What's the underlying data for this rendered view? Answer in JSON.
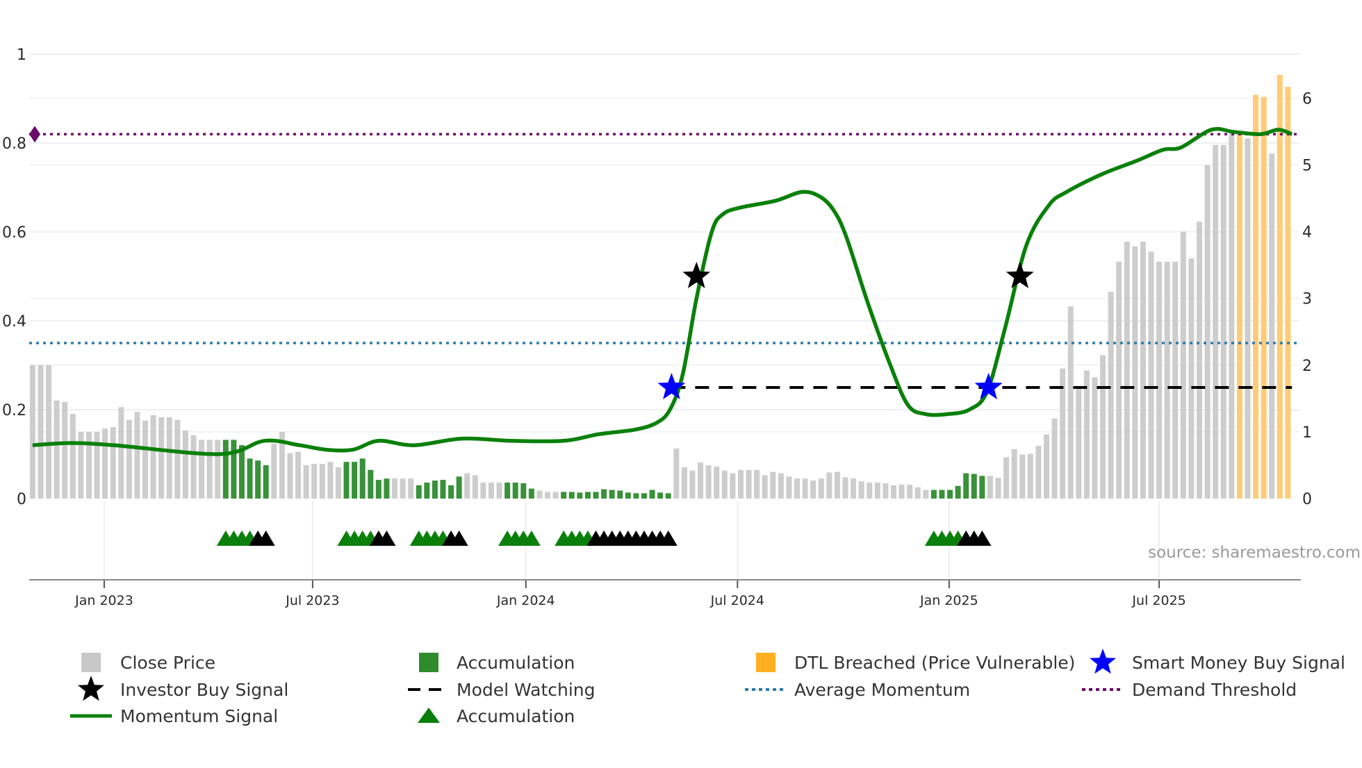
{
  "chart_data": {
    "type": "bar+line",
    "title": "",
    "left_axis": {
      "ylim": [
        0,
        1
      ],
      "ticks": [
        0,
        0.2,
        0.4,
        0.6,
        0.8,
        1
      ],
      "tick_labels": [
        "0",
        "0.2",
        "0.4",
        "0.6",
        "0.8",
        "1"
      ]
    },
    "right_axis": {
      "ylim": [
        0,
        6.35
      ],
      "ticks": [
        0,
        1,
        2,
        3,
        4,
        5,
        6
      ],
      "tick_labels": [
        "0",
        "1",
        "2",
        "3",
        "4",
        "5",
        "6"
      ]
    },
    "x_ticks": [
      {
        "week": 8.9,
        "label": "Jan 2023"
      },
      {
        "week": 34.8,
        "label": "Jul 2023"
      },
      {
        "week": 61.3,
        "label": "Jan 2024"
      },
      {
        "week": 87.6,
        "label": "Jul 2024"
      },
      {
        "week": 113.9,
        "label": "Jan 2025"
      },
      {
        "week": 140.0,
        "label": "Jul 2025"
      }
    ],
    "bars": {
      "axis": "right",
      "segments": [
        {
          "type": "close",
          "values": [
            2.0,
            2.0,
            2.0,
            1.47,
            1.45,
            1.27,
            1.0,
            1.0,
            1.0,
            1.05,
            1.07,
            1.37,
            1.18,
            1.3,
            1.17,
            1.25,
            1.22,
            1.22,
            1.18,
            1.02,
            0.95,
            0.88,
            0.88,
            0.88
          ]
        },
        {
          "type": "accum",
          "values": [
            0.88,
            0.88,
            0.8,
            0.6,
            0.57,
            0.5
          ]
        },
        {
          "type": "close",
          "values": [
            0.82,
            1.0,
            0.68,
            0.7,
            0.5,
            0.52,
            0.52,
            0.55,
            0.47
          ]
        },
        {
          "type": "accum",
          "values": [
            0.55,
            0.55,
            0.6,
            0.43,
            0.28,
            0.3
          ]
        },
        {
          "type": "close",
          "values": [
            0.3,
            0.3,
            0.3
          ]
        },
        {
          "type": "accum",
          "values": [
            0.2,
            0.24,
            0.27,
            0.28,
            0.2,
            0.33
          ]
        },
        {
          "type": "close",
          "values": [
            0.38,
            0.35,
            0.24,
            0.24,
            0.24
          ]
        },
        {
          "type": "accum",
          "values": [
            0.24,
            0.24,
            0.23,
            0.15
          ]
        },
        {
          "type": "close",
          "values": [
            0.12,
            0.1,
            0.1
          ]
        },
        {
          "type": "accum",
          "values": [
            0.1,
            0.1,
            0.09,
            0.1,
            0.1,
            0.14,
            0.13,
            0.12,
            0.09,
            0.08,
            0.08,
            0.13,
            0.09,
            0.08
          ]
        },
        {
          "type": "close",
          "values": [
            0.75,
            0.47,
            0.42,
            0.54,
            0.5,
            0.48,
            0.42,
            0.38,
            0.43,
            0.43,
            0.43,
            0.35,
            0.4,
            0.38,
            0.33,
            0.3,
            0.3,
            0.27,
            0.3,
            0.39,
            0.4,
            0.32,
            0.3,
            0.26,
            0.24,
            0.24,
            0.23,
            0.2,
            0.21,
            0.21,
            0.17,
            0.13
          ]
        },
        {
          "type": "accum",
          "values": [
            0.13,
            0.13,
            0.13,
            0.19,
            0.38,
            0.37,
            0.34
          ]
        },
        {
          "type": "close",
          "values": [
            0.34,
            0.31,
            0.62,
            0.74,
            0.66,
            0.67,
            0.79,
            0.96,
            1.2,
            1.95,
            2.88,
            1.65,
            1.92,
            1.82,
            2.15,
            3.1,
            3.55,
            3.85,
            3.78,
            3.85,
            3.7,
            3.55,
            3.55,
            3.55,
            4.0,
            3.6,
            4.15,
            5.0,
            5.3,
            5.3,
            5.47
          ]
        },
        {
          "type": "dtl",
          "values": [
            5.47
          ]
        },
        {
          "type": "close",
          "values": [
            5.4
          ]
        },
        {
          "type": "dtl",
          "values": [
            6.05,
            6.02
          ]
        },
        {
          "type": "close",
          "values": [
            5.17
          ]
        },
        {
          "type": "dtl",
          "values": [
            6.35,
            6.17
          ]
        }
      ]
    },
    "momentum": {
      "axis": "left",
      "points": [
        [
          0,
          0.12
        ],
        [
          4.7,
          0.125
        ],
        [
          10.2,
          0.12
        ],
        [
          23.3,
          0.1
        ],
        [
          28.8,
          0.13
        ],
        [
          33.2,
          0.12
        ],
        [
          36.5,
          0.11
        ],
        [
          39.8,
          0.11
        ],
        [
          43,
          0.13
        ],
        [
          47.4,
          0.12
        ],
        [
          53.4,
          0.135
        ],
        [
          59.5,
          0.13
        ],
        [
          66,
          0.13
        ],
        [
          70.4,
          0.145
        ],
        [
          74.8,
          0.155
        ],
        [
          77.5,
          0.17
        ],
        [
          79.2,
          0.2
        ],
        [
          80.8,
          0.28
        ],
        [
          82.5,
          0.45
        ],
        [
          84.4,
          0.6
        ],
        [
          85.8,
          0.64
        ],
        [
          88,
          0.655
        ],
        [
          92.3,
          0.67
        ],
        [
          95.6,
          0.69
        ],
        [
          97.8,
          0.68
        ],
        [
          99.5,
          0.65
        ],
        [
          101.1,
          0.59
        ],
        [
          103.8,
          0.44
        ],
        [
          106.6,
          0.3
        ],
        [
          108.8,
          0.21
        ],
        [
          111,
          0.19
        ],
        [
          113.7,
          0.19
        ],
        [
          116.4,
          0.2
        ],
        [
          118.6,
          0.24
        ],
        [
          120.8,
          0.38
        ],
        [
          123.5,
          0.57
        ],
        [
          126.3,
          0.66
        ],
        [
          128.5,
          0.69
        ],
        [
          132.9,
          0.73
        ],
        [
          137.2,
          0.76
        ],
        [
          140.5,
          0.785
        ],
        [
          142.7,
          0.79
        ],
        [
          146.5,
          0.83
        ],
        [
          149.3,
          0.825
        ],
        [
          152.6,
          0.82
        ],
        [
          154.8,
          0.83
        ],
        [
          156.5,
          0.82
        ]
      ]
    },
    "demand_threshold": 0.82,
    "average_momentum": 0.35,
    "model_watching": {
      "value": 0.25,
      "from_week": 79.4,
      "to_week": 156.5
    },
    "investor_buy_signals": [
      {
        "week": 82.5,
        "value": 0.5
      },
      {
        "week": 122.7,
        "value": 0.5
      }
    ],
    "smart_money_buy_signals": [
      {
        "week": 79.4,
        "value": 0.25
      },
      {
        "week": 118.8,
        "value": 0.25
      }
    ],
    "accumulation_markers": {
      "green": [
        24,
        25,
        26,
        27,
        39,
        40,
        41,
        42,
        48,
        49,
        50,
        51,
        59,
        60,
        61,
        62,
        66,
        67,
        68,
        69,
        112,
        113,
        114,
        115
      ],
      "black": [
        28,
        29,
        43,
        44,
        52,
        53,
        70,
        71,
        72,
        73,
        74,
        75,
        76,
        77,
        78,
        79,
        116,
        117,
        118
      ]
    },
    "colors": {
      "close": "#c8c8c8",
      "accum": "#2e8b2e",
      "dtl": "#ffc870",
      "momentum": "#0a800a",
      "demand": "#6a0a6a",
      "avg": "#2e7aa8",
      "watch": "#000000",
      "smart": "#0000ff",
      "investor": "#000000"
    }
  },
  "source": "source: sharemaestro.com",
  "legend": [
    {
      "key": "close",
      "label": "Close Price"
    },
    {
      "key": "accum-bar",
      "label": "Accumulation"
    },
    {
      "key": "dtl",
      "label": "DTL Breached (Price Vulnerable)"
    },
    {
      "key": "smart",
      "label": "Smart Money Buy Signal"
    },
    {
      "key": "investor",
      "label": "Investor Buy Signal"
    },
    {
      "key": "watch",
      "label": "Model Watching"
    },
    {
      "key": "avg",
      "label": "Average Momentum"
    },
    {
      "key": "demand",
      "label": "Demand Threshold"
    },
    {
      "key": "momentum",
      "label": "Momentum Signal"
    },
    {
      "key": "accum-tri",
      "label": "Accumulation"
    }
  ]
}
